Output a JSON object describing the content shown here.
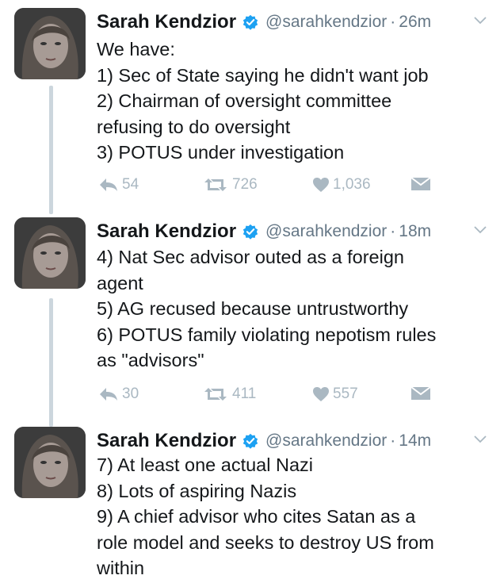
{
  "tweets": [
    {
      "name": "Sarah Kendzior",
      "handle": "@sarahkendzior",
      "separator": "·",
      "time": "26m",
      "lines": [
        "We have:",
        "1) Sec of State saying he didn't want job",
        "2) Chairman of oversight committee",
        "refusing to do oversight",
        "3) POTUS under investigation"
      ],
      "replies": "54",
      "retweets": "726",
      "likes": "1,036"
    },
    {
      "name": "Sarah Kendzior",
      "handle": "@sarahkendzior",
      "separator": "·",
      "time": "18m",
      "lines": [
        "4) Nat Sec advisor outed as a foreign",
        "agent",
        "5) AG recused because untrustworthy",
        "6) POTUS family violating nepotism rules",
        "as \"advisors\""
      ],
      "replies": "30",
      "retweets": "411",
      "likes": "557"
    },
    {
      "name": "Sarah Kendzior",
      "handle": "@sarahkendzior",
      "separator": "·",
      "time": "14m",
      "lines": [
        "7) At least one actual Nazi",
        "8) Lots of aspiring Nazis",
        "9) A chief advisor who cites Satan as a",
        "role model and seeks to destroy US from",
        "within"
      ]
    }
  ],
  "icons": {
    "reply": "reply-icon",
    "retweet": "retweet-icon",
    "like": "heart-icon",
    "dm": "envelope-icon",
    "verified": "verified-badge-icon",
    "more": "chevron-down-icon"
  },
  "colors": {
    "verified": "#1da1f2",
    "meta": "#657786",
    "action": "#aab8c2",
    "thread_line": "#ccd6dd"
  }
}
